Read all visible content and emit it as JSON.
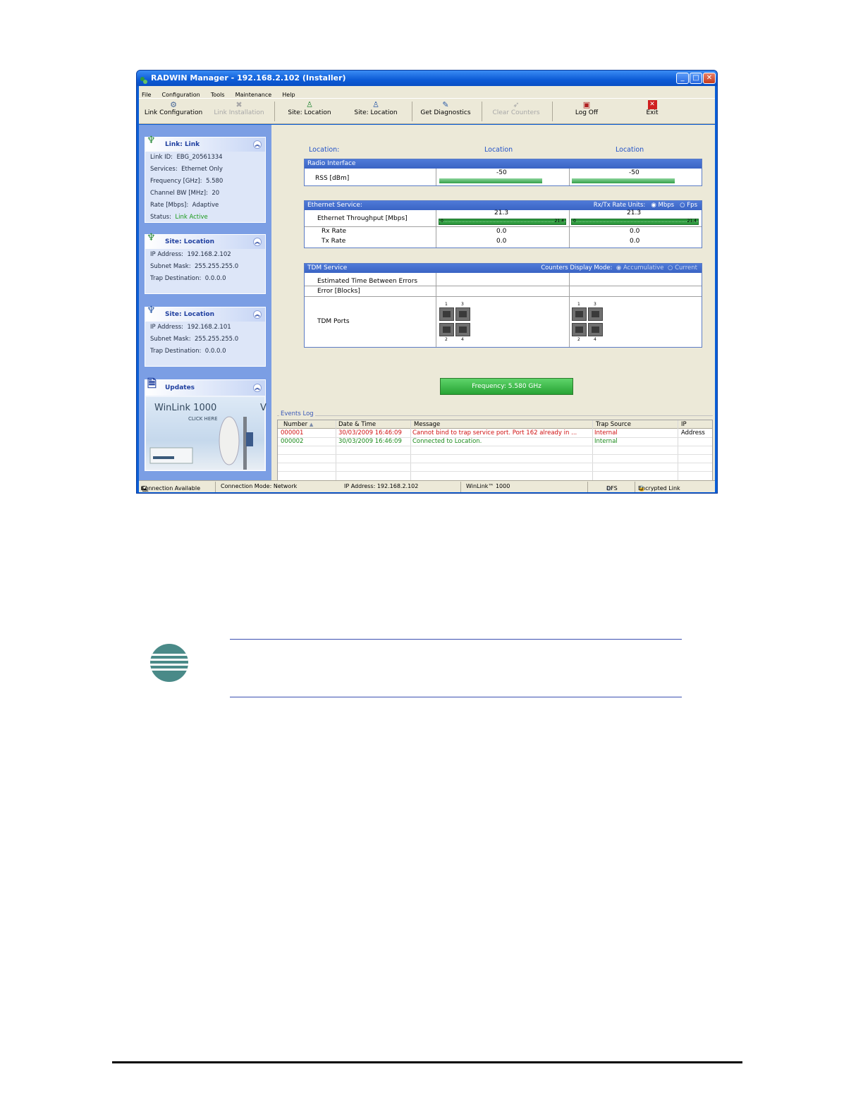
{
  "window": {
    "title": "RADWIN Manager - 192.168.2.102 (Installer)",
    "controls": {
      "minimize": "_",
      "maximize": "□",
      "close": "✕"
    }
  },
  "menu": [
    "File",
    "Configuration",
    "Tools",
    "Maintenance",
    "Help"
  ],
  "toolbar": [
    {
      "label": "Link Configuration",
      "icon": "link-config-icon",
      "enabled": true
    },
    {
      "label": "Link Installation",
      "icon": "tools-icon",
      "enabled": false
    },
    {
      "label": "Site: Location",
      "icon": "site-icon",
      "enabled": true
    },
    {
      "label": "Site: Location",
      "icon": "site-icon",
      "enabled": true
    },
    {
      "label": "Get Diagnostics",
      "icon": "diagnostics-icon",
      "enabled": true
    },
    {
      "label": "Clear Counters",
      "icon": "eraser-icon",
      "enabled": false
    },
    {
      "label": "Log Off",
      "icon": "logoff-icon",
      "enabled": true
    },
    {
      "label": "Exit",
      "icon": "exit-icon",
      "enabled": true
    }
  ],
  "sidebar": {
    "link_panel": {
      "title": "Link: Link",
      "rows": [
        {
          "label": "Link ID:",
          "value": "EBG_20561334"
        },
        {
          "label": "Services:",
          "value": "Ethernet Only"
        },
        {
          "label": "Frequency [GHz]:",
          "value": "5.580"
        },
        {
          "label": "Channel BW [MHz]:",
          "value": "20"
        },
        {
          "label": "Rate [Mbps]:",
          "value": "Adaptive"
        },
        {
          "label": "Status:",
          "value": "Link Active"
        }
      ]
    },
    "site1_panel": {
      "title": "Site: Location",
      "rows": [
        {
          "label": "IP Address:",
          "value": "192.168.2.102"
        },
        {
          "label": "Subnet Mask:",
          "value": "255.255.255.0"
        },
        {
          "label": "Trap Destination:",
          "value": "0.0.0.0"
        }
      ]
    },
    "site2_panel": {
      "title": "Site: Location",
      "rows": [
        {
          "label": "IP Address:",
          "value": "192.168.2.101"
        },
        {
          "label": "Subnet Mask:",
          "value": "255.255.255.0"
        },
        {
          "label": "Trap Destination:",
          "value": "0.0.0.0"
        }
      ]
    },
    "updates": {
      "title": "Updates",
      "banner_title": "WinLink 1000",
      "banner_sub": "CLICK HERE",
      "banner_trail": "V"
    }
  },
  "main": {
    "location_caption": "Location:",
    "site_a": "Location",
    "site_b": "Location",
    "radio": {
      "title": "Radio Interface",
      "rss_label": "RSS [dBm]",
      "rss_a": "-50",
      "rss_b": "-50",
      "rss_fill_a": 0.8,
      "rss_fill_b": 0.8
    },
    "ethernet": {
      "title": "Ethernet Service:",
      "units_label": "Rx/Tx Rate Units:",
      "units_options": [
        "Mbps",
        "Fps"
      ],
      "units_selected": "Mbps",
      "throughput_label": "Ethernet Throughput [Mbps]",
      "throughput_a": "21.3",
      "throughput_b": "21.3",
      "scale_min": "0",
      "scale_max": "21.4",
      "rx_label": "Rx Rate",
      "rx_a": "0.0",
      "rx_b": "0.0",
      "tx_label": "Tx Rate",
      "tx_a": "0.0",
      "tx_b": "0.0"
    },
    "tdm": {
      "title": "TDM Service",
      "mode_label": "Counters Display Mode:",
      "mode_options": [
        "Accumulative",
        "Current"
      ],
      "etbe_label": "Estimated Time Between Errors",
      "error_label": "Error [Blocks]",
      "ports_label": "TDM Ports",
      "port_numbers": [
        "1",
        "3",
        "2",
        "4"
      ]
    },
    "frequency_button": "Frequency: 5.580 GHz"
  },
  "events_log": {
    "title": "Events Log",
    "columns": [
      "Number",
      "Date & Time",
      "Message",
      "Trap Source",
      "IP Address"
    ],
    "rows": [
      {
        "number": "000001",
        "datetime": "30/03/2009 16:46:09",
        "message": "Cannot bind to trap service port. Port 162 already in ...",
        "source": "Internal",
        "ip": "",
        "color": "#d01010"
      },
      {
        "number": "000002",
        "datetime": "30/03/2009 16:46:09",
        "message": "Connected to Location.",
        "source": "Internal",
        "ip": "",
        "color": "#1a8a1a"
      }
    ]
  },
  "statusbar": {
    "connection": "Connection Available",
    "mode": "Connection Mode: Network",
    "ip": "IP Address: 192.168.2.102",
    "product": "WinLink™ 1000",
    "dfs": "DFS",
    "encrypted": "Encrypted Link"
  }
}
